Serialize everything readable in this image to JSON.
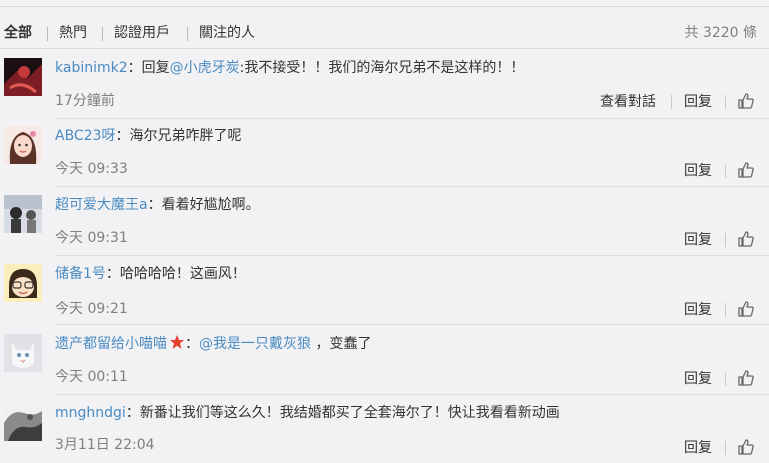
{
  "tabs": [
    {
      "label": "全部"
    },
    {
      "label": "熱門"
    },
    {
      "label": "認證用戶"
    },
    {
      "label": "關注的人"
    }
  ],
  "total": "共 3220 條",
  "actions": {
    "view_conversation": "查看對話",
    "reply": "回复"
  },
  "icons": {
    "like": "thumbs-up-icon",
    "badge": "star-badge-icon"
  },
  "colors": {
    "username": "#4a8bc2",
    "background": "#f2f2f5",
    "badge": "#e8402f"
  },
  "comments": [
    {
      "user": "kabinimk2",
      "sep": "：",
      "prefix": "回复",
      "mention": "@小虎牙炭",
      "text": ":我不接受！！我们的海尔兄弟不是这样的！！",
      "time": "17分鐘前"
    },
    {
      "user": "ABC23呀",
      "sep": "：",
      "text": "海尔兄弟咋胖了呢",
      "time": "今天 09:33"
    },
    {
      "user": "超可爱大魔王a",
      "sep": "：",
      "text": "看着好尴尬啊。",
      "time": "今天 09:31"
    },
    {
      "user": "储备1号",
      "sep": "：",
      "text": "哈哈哈哈！这画风！",
      "time": "今天 09:21"
    },
    {
      "user": "遗产都留给小喵喵",
      "sep": "：",
      "mention": "@我是一只戴灰狼",
      "text": " ，变蠢了",
      "time": "今天 00:11"
    },
    {
      "user": "mnghndgi",
      "sep": "：",
      "text": "新番让我们等这么久！我结婚都买了全套海尔了！快让我看看新动画",
      "time": "3月11日 22:04"
    }
  ]
}
